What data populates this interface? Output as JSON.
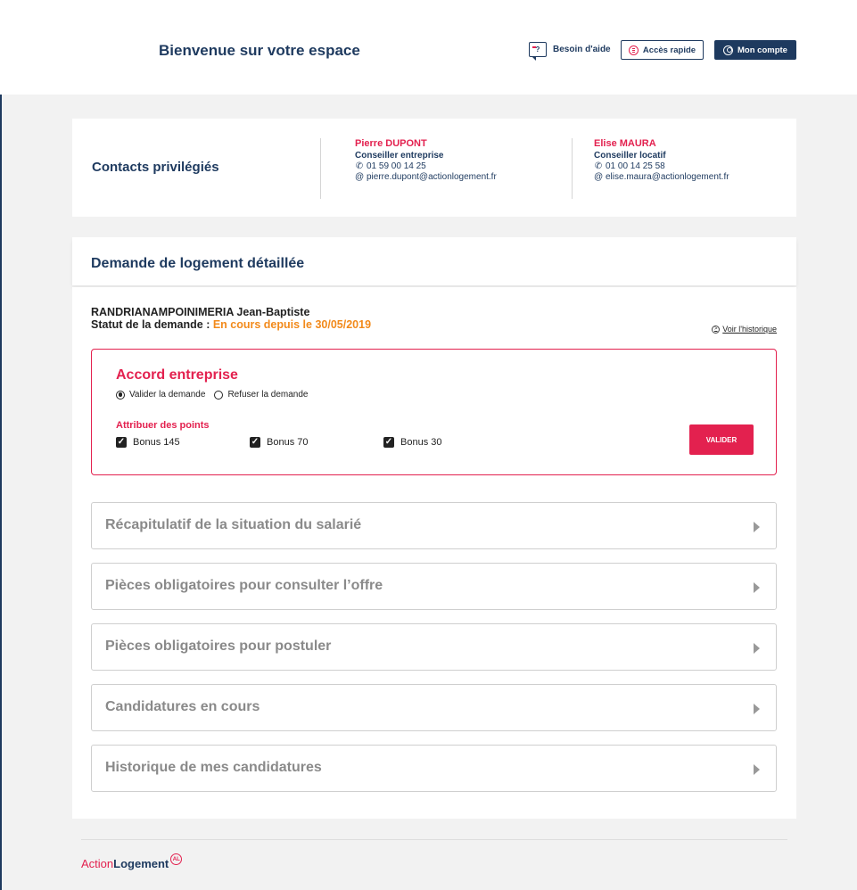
{
  "header": {
    "title": "Bienvenue sur votre espace",
    "help_label": "Besoin d'aide",
    "acces_label": "Accès rapide",
    "compte_label": "Mon compte"
  },
  "contacts": {
    "heading": "Contacts privilégiés",
    "people": [
      {
        "name": "Pierre DUPONT",
        "role": "Conseiller entreprise",
        "phone": "01 59 00 14 25",
        "email": "pierre.dupont@actionlogement.fr"
      },
      {
        "name": "Elise MAURA",
        "role": "Conseiller locatif",
        "phone": "01 00 14 25 58",
        "email": "elise.maura@actionlogement.fr"
      }
    ],
    "at_symbol": "@"
  },
  "demande": {
    "heading": "Demande de logement détaillée",
    "applicant": "RANDRIANAMPOINIMERIA Jean-Baptiste",
    "status_label": "Statut de la demande : ",
    "status_value": "En cours depuis le 30/05/2019",
    "history_link": "Voir l'historique"
  },
  "accord": {
    "title": "Accord entreprise",
    "radio_valider": "Valider la demande",
    "radio_refuser": "Refuser la demande",
    "selected": "valider",
    "points_label": "Attribuer des points",
    "bonuses": [
      "Bonus 145",
      "Bonus 70",
      "Bonus 30"
    ],
    "submit": "VALIDER"
  },
  "sections": [
    "Récapitulatif de la situation du salarié",
    "Pièces obligatoires pour consulter l’offre",
    "Pièces obligatoires pour postuler",
    "Candidatures en cours",
    "Historique de mes candidatures"
  ],
  "footer": {
    "logo_part1": "Action",
    "logo_part2": "Logement",
    "logo_mark": "AL"
  },
  "colors": {
    "navy": "#1e3a5f",
    "accent": "#e3214f",
    "status": "#f28a1b"
  }
}
